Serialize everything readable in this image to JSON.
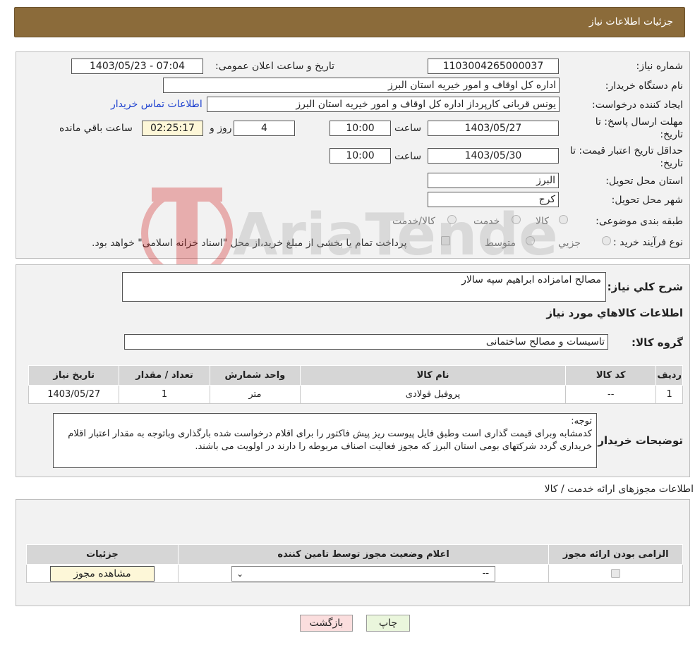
{
  "header": {
    "title": "جزئیات اطلاعات نیاز"
  },
  "details": {
    "need_number_label": "شماره نیاز:",
    "need_number": "1103004265000037",
    "announce_label": "تاریخ و ساعت اعلان عمومی:",
    "announce_value": "1403/05/23 - 07:04",
    "buyer_org_label": "نام دستگاه خریدار:",
    "buyer_org": "اداره کل اوقاف و امور خیریه استان البرز",
    "requester_label": "ایجاد کننده درخواست:",
    "requester": "یونس قربانی کارپرداز اداره کل اوقاف و امور خیریه استان البرز",
    "contact_link": "اطلاعات تماس خریدار",
    "deadline_label_1": "مهلت ارسال پاسخ: تا",
    "deadline_label_2": "تاریخ:",
    "deadline_date": "1403/05/27",
    "time_word": "ساعت",
    "deadline_time": "10:00",
    "days_value": "4",
    "days_word": "روز و",
    "remaining_time": "02:25:17",
    "remaining_word": "ساعت باقي مانده",
    "price_validity_label_1": "حداقل تاریخ اعتبار قیمت: تا",
    "price_validity_label_2": "تاریخ:",
    "price_validity_date": "1403/05/30",
    "price_validity_time": "10:00",
    "province_label": "استان محل تحویل:",
    "province": "البرز",
    "city_label": "شهر محل تحویل:",
    "city": "کرج",
    "category_label": "طبقه بندی موضوعی:",
    "category_options": [
      "کالا",
      "خدمت",
      "کالا/خدمت"
    ],
    "process_label": "نوع فرآیند خرید :",
    "process_options": [
      "جزیي",
      "متوسط"
    ],
    "payment_note": "پرداخت تمام یا بخشی از مبلغ خرید،از محل \"اسناد خزانه اسلامی\" خواهد بود."
  },
  "watermark": {
    "text": "AriaTender.neT"
  },
  "summary": {
    "description_label": "شرح کلي نياز:",
    "description": "مصالح امامزاده ابراهیم سپه سالار",
    "goods_info_title": "اطلاعات کالاهاي مورد نياز",
    "goods_group_label": "گروه کالا:",
    "goods_group": "تاسیسات و مصالح ساختمانی",
    "table_headers": [
      "رديف",
      "کد کالا",
      "نام کالا",
      "واحد شمارش",
      "تعداد / مقدار",
      "تاریخ نیاز"
    ],
    "rows": [
      [
        "1",
        "--",
        "پروفیل فولادی",
        "متر",
        "1",
        "1403/05/27"
      ]
    ],
    "buyer_notes_label": "توضيحات خريدار:",
    "buyer_notes": "توجه:\nکدمشابه وبرای قیمت گذاری است وطبق فایل پیوست ریز پیش فاکتور را برای اقلام درخواست شده بارگذاری وباتوجه به مقدار اعتبار اقلام خریداری گردد شرکتهای بومی استان البرز که مجوز فعالیت اصناف مربوطه را دارند در اولویت می باشند."
  },
  "permits": {
    "section_title": "اطلاعات مجوزهای ارائه خدمت / کالا",
    "headers": [
      "الزامی بودن ارائه مجوز",
      "اعلام وضعیت مجوز توسط تامین کننده",
      "جزئیات"
    ],
    "select_value": "--",
    "view_button": "مشاهده مجوز"
  },
  "actions": {
    "print": "چاپ",
    "back": "بازگشت"
  }
}
